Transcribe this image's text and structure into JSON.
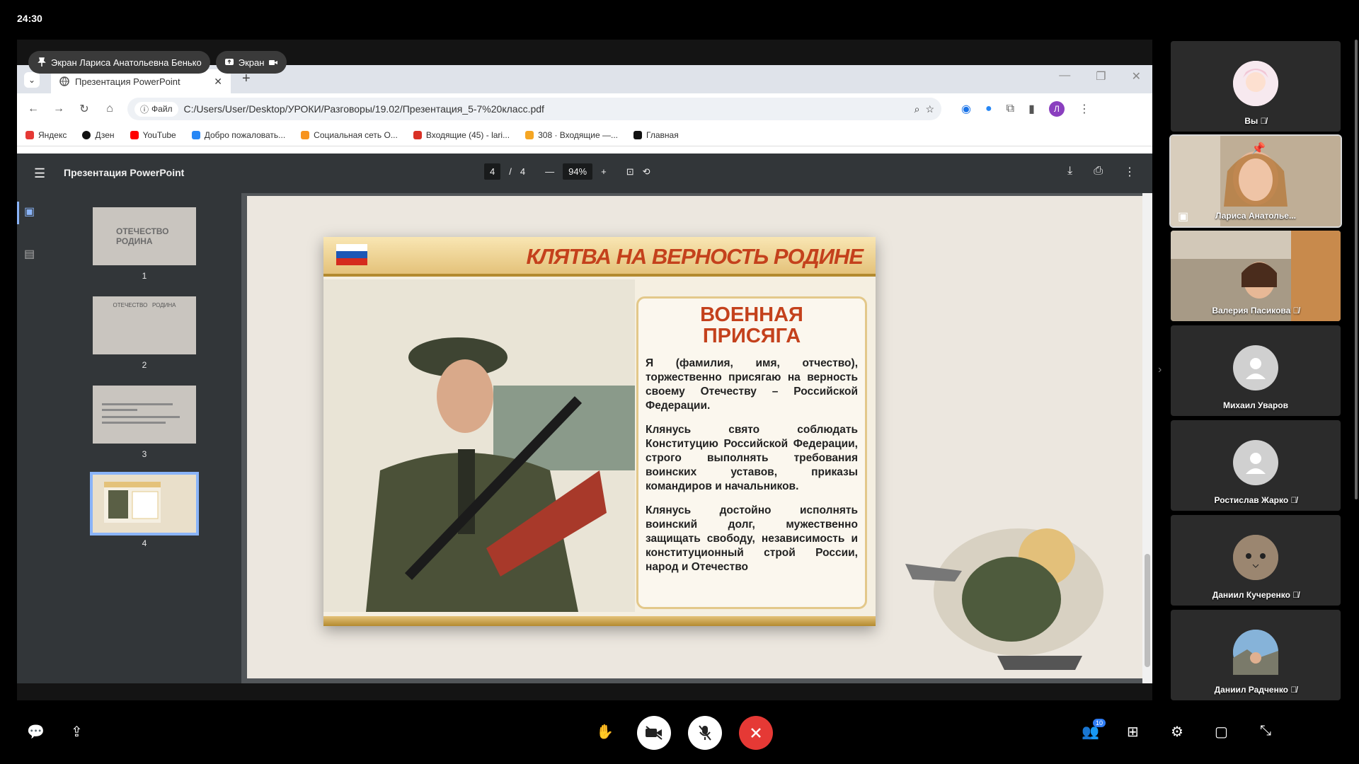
{
  "status": {
    "clock": "24:30"
  },
  "share": {
    "presenter_pill": "Экран Лариса Анатольевна Бенько",
    "screen_pill": "Экран"
  },
  "browser": {
    "tab_title": "Презентация PowerPoint",
    "file_chip": "Файл",
    "url": "C:/Users/User/Desktop/УРОКИ/Разговоры/19.02/Презентация_5-7%20класс.pdf",
    "avatar_letter": "Л",
    "bookmarks": [
      {
        "label": "Яндекс",
        "color": "#e53935"
      },
      {
        "label": "Дзен",
        "color": "#111111"
      },
      {
        "label": "YouTube",
        "color": "#ff0000"
      },
      {
        "label": "Добро пожаловать...",
        "color": "#2787f5"
      },
      {
        "label": "Социальная сеть О...",
        "color": "#f7931e"
      },
      {
        "label": "Входящие (45) - lari...",
        "color": "#d93025"
      },
      {
        "label": "308 · Входящие —...",
        "color": "#f5a623"
      },
      {
        "label": "Главная",
        "color": "#111111"
      }
    ]
  },
  "pdf": {
    "title": "Презентация PowerPoint",
    "page_current": "4",
    "page_total": "4",
    "zoom": "94%",
    "thumbnails": [
      {
        "num": "1",
        "text": "ОТЕЧЕСТВО РОДИНА"
      },
      {
        "num": "2",
        "text": "ОТЕЧЕСТВО   РОДИНА"
      },
      {
        "num": "3",
        "text": ""
      },
      {
        "num": "4",
        "text": ""
      }
    ]
  },
  "slide": {
    "header": "КЛЯТВА НА ВЕРНОСТЬ РОДИНЕ",
    "title_line1": "ВОЕННАЯ",
    "title_line2": "ПРИСЯГА",
    "p1": "Я (фамилия, имя, отчество), торжественно присягаю на верность своему Отечеству – Российской Федерации.",
    "p2": "Клянусь свято соблюдать Конституцию Российской Федерации, строго выполнять требования воинских уставов, приказы командиров и начальников.",
    "p3": "Клянусь достойно исполнять воинский долг, мужественно защищать свободу, независимость и конституционный строй России, народ и Отечество"
  },
  "participants": [
    {
      "name": "Вы",
      "muted": true
    },
    {
      "name": "Лариса Анатолье...",
      "muted": false,
      "active": true
    },
    {
      "name": "Валерия Пасикова",
      "muted": true
    },
    {
      "name": "Михаил Уваров",
      "muted": false
    },
    {
      "name": "Ростислав Жарко",
      "muted": true
    },
    {
      "name": "Даниил Кучеренко",
      "muted": true
    },
    {
      "name": "Даниил Радченко",
      "muted": true
    }
  ],
  "controls": {
    "participants_count": "10"
  },
  "colors": {
    "end_call": "#e53935",
    "accent": "#8ab4f8"
  }
}
